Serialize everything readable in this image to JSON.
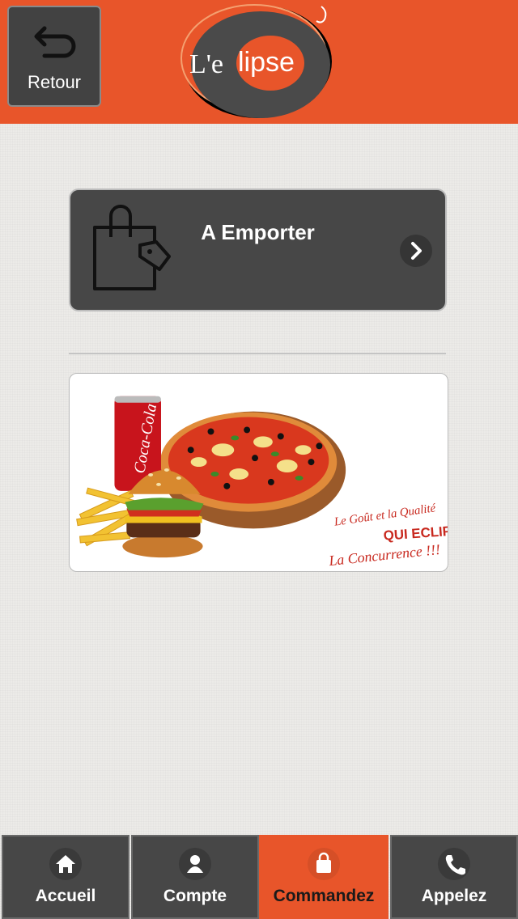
{
  "header": {
    "back_label": "Retour",
    "back_icon": "undo-arrow-icon",
    "logo_text_left": "L'e",
    "logo_text_right": "lipse",
    "accent_color": "#e8552a"
  },
  "main": {
    "emporter": {
      "title": "A Emporter",
      "icon": "shopping-bag-icon",
      "chevron_icon": "chevron-right-icon"
    },
    "banner": {
      "line1": "Le Goût et la Qualité",
      "line2": "QUI ECLIPSE",
      "line3": "La Concurrence !!!",
      "can_text": "Coca-Cola"
    }
  },
  "tabbar": {
    "items": [
      {
        "label": "Accueil",
        "icon": "home-icon"
      },
      {
        "label": "Compte",
        "icon": "user-icon"
      },
      {
        "label": "Commandez",
        "icon": "bag-icon",
        "active": true
      },
      {
        "label": "Appelez",
        "icon": "phone-icon"
      }
    ]
  }
}
